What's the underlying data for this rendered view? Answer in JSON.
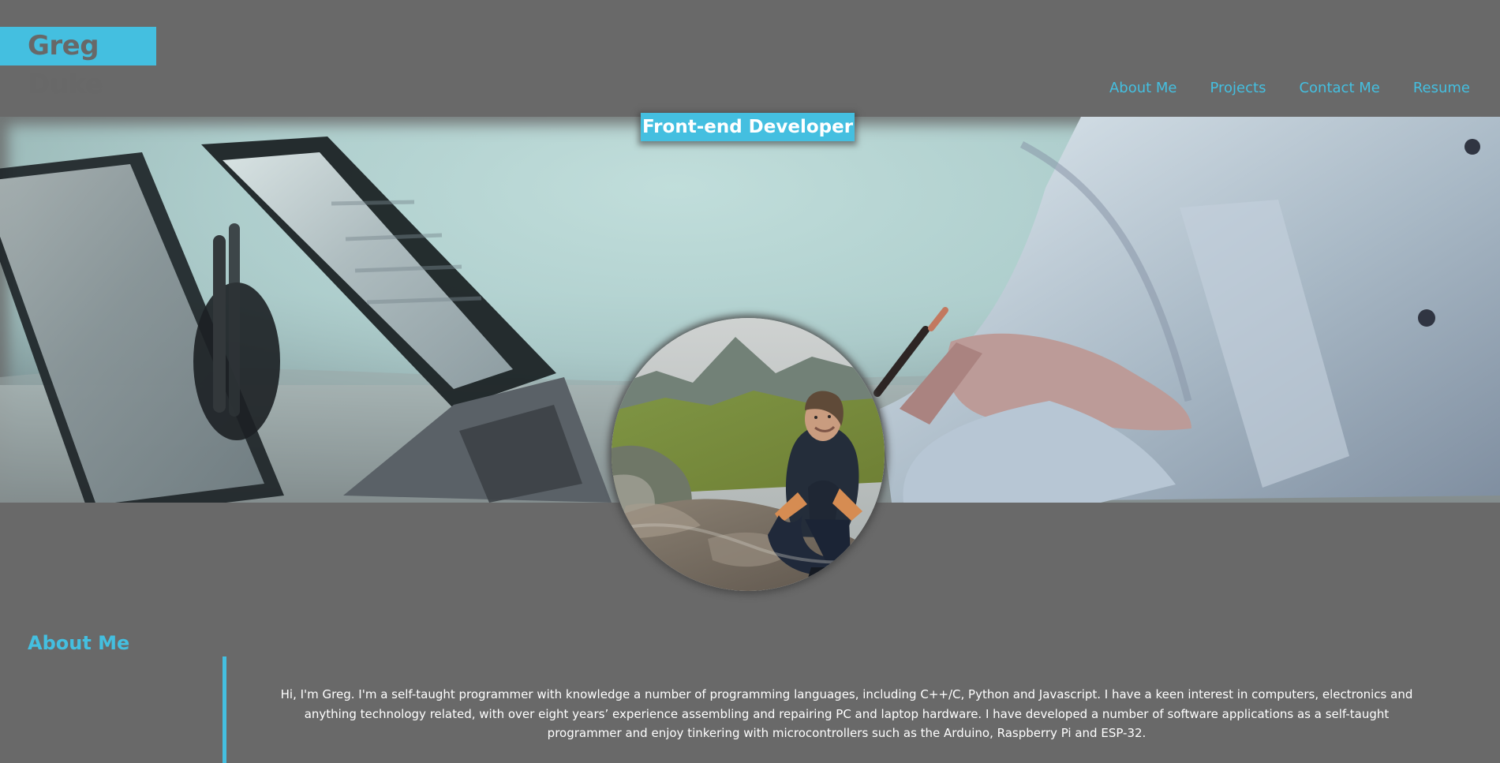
{
  "header": {
    "name": "Greg Duke"
  },
  "nav": {
    "items": [
      {
        "label": "About Me"
      },
      {
        "label": "Projects"
      },
      {
        "label": "Contact Me"
      },
      {
        "label": "Resume"
      }
    ]
  },
  "hero": {
    "role": "Front-end Developer"
  },
  "about": {
    "title": "About Me",
    "body": "Hi, I'm Greg. I'm a self-taught programmer with knowledge a number of programming languages, including C++/C, Python and Javascript. I have a keen interest in computers, electronics and anything technology related, with over eight years’ experience assembling and repairing PC and laptop hardware. I have developed a number of software applications as a self-taught programmer and enjoy tinkering with microcontrollers such as the Arduino, Raspberry Pi and ESP-32."
  },
  "colors": {
    "accent": "#44bfe0",
    "background": "#696969",
    "brand_text": "#686868",
    "body_text": "#ffffff"
  }
}
